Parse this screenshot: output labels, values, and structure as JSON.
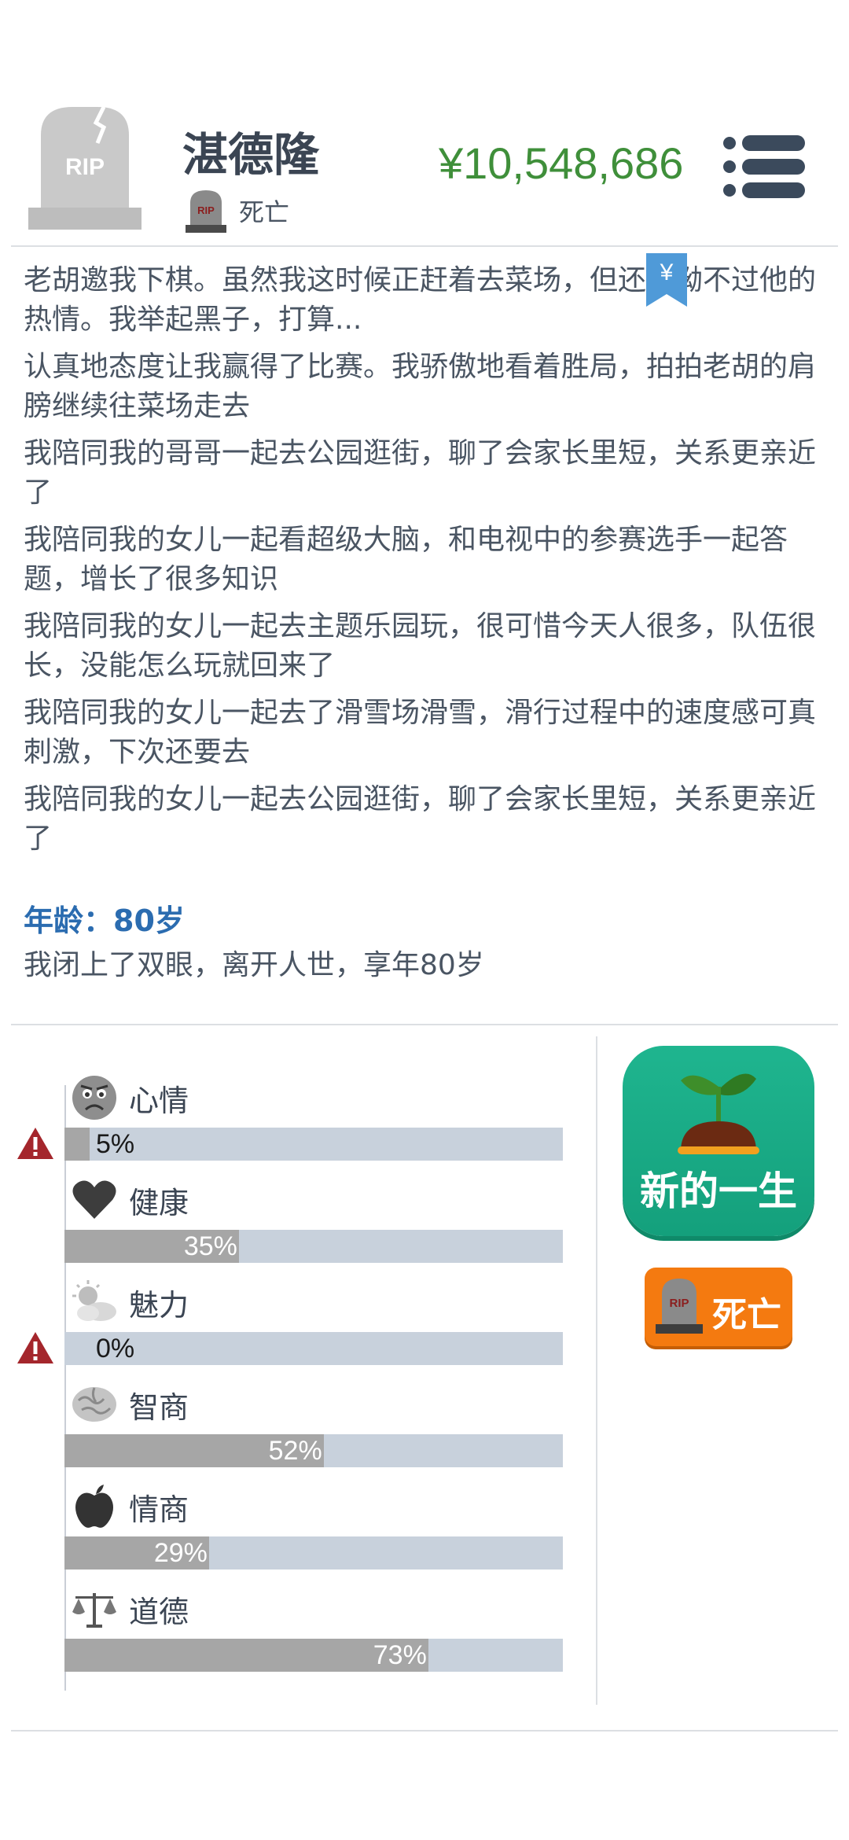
{
  "header": {
    "avatar_text": "RIP",
    "name": "湛德隆",
    "status": "死亡",
    "status_icon_text": "RIP",
    "money": "¥10,548,686",
    "menu_icon": "list-menu-icon"
  },
  "log": [
    "老胡邀我下棋。虽然我这时候正赶着去菜场，但还是拗不过他的热情。我举起黑子，打算...",
    "认真地态度让我赢得了比赛。我骄傲地看着胜局，拍拍老胡的肩膀继续往菜场走去",
    "我陪同我的哥哥一起去公园逛街，聊了会家长里短，关系更亲近了",
    "我陪同我的女儿一起看超级大脑，和电视中的参赛选手一起答题，增长了很多知识",
    "我陪同我的女儿一起去主题乐园玩，很可惜今天人很多，队伍很长，没能怎么玩就回来了",
    "我陪同我的女儿一起去了滑雪场滑雪，滑行过程中的速度感可真刺激，下次还要去",
    "我陪同我的女儿一起去公园逛街，聊了会家长里短，关系更亲近了"
  ],
  "yen_badge": "¥",
  "age_line": "年龄：80岁",
  "death_message": "我闭上了双眼，离开人世，享年80岁",
  "stats": [
    {
      "label": "心情",
      "percent": 5,
      "text": "5%",
      "icon": "sad-face-icon",
      "warning": true
    },
    {
      "label": "健康",
      "percent": 35,
      "text": "35%",
      "icon": "heart-icon",
      "warning": false
    },
    {
      "label": "魅力",
      "percent": 0,
      "text": "0%",
      "icon": "sun-cloud-icon",
      "warning": true
    },
    {
      "label": "智商",
      "percent": 52,
      "text": "52%",
      "icon": "brain-icon",
      "warning": false
    },
    {
      "label": "情商",
      "percent": 29,
      "text": "29%",
      "icon": "apple-icon",
      "warning": false
    },
    {
      "label": "道德",
      "percent": 73,
      "text": "73%",
      "icon": "scales-icon",
      "warning": false
    }
  ],
  "buttons": {
    "new_life": "新的一生",
    "dead": "死亡",
    "dead_icon_text": "RIP"
  },
  "colors": {
    "money": "#3f8f3a",
    "age": "#2b6cb0",
    "new_life_bg": "#14a07c",
    "dead_bg": "#f47a10",
    "bar_track": "#c8d1dc",
    "bar_fill": "#a6a6a6",
    "warning": "#a4262c"
  }
}
